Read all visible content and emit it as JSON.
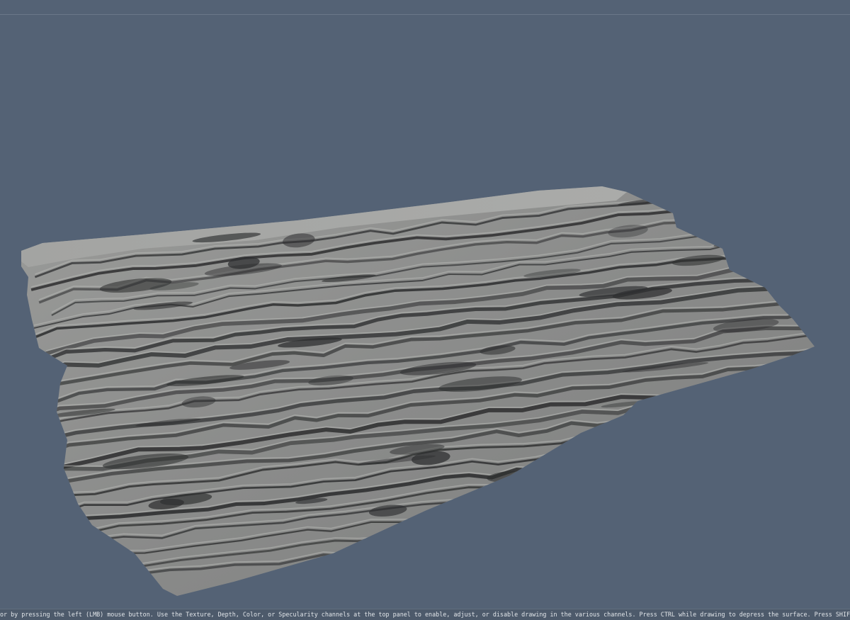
{
  "viewport": {
    "model_name": "bark-surface-mesh",
    "background_color": "#546275",
    "surface_color": "#8c8d8c",
    "crack_color": "#2e2f30",
    "highlight_color": "#b4b5b3"
  },
  "status_bar": {
    "text": "or by pressing the left (LMB) mouse button. Use the Texture, Depth, Color, or Specularity channels at the top panel to enable, adjust, or disable drawing in the various channels. Press CTRL while drawing to depress the surface. Press SHIFT to smooth the active channel(s) while you draw. Navigate the camera with"
  }
}
